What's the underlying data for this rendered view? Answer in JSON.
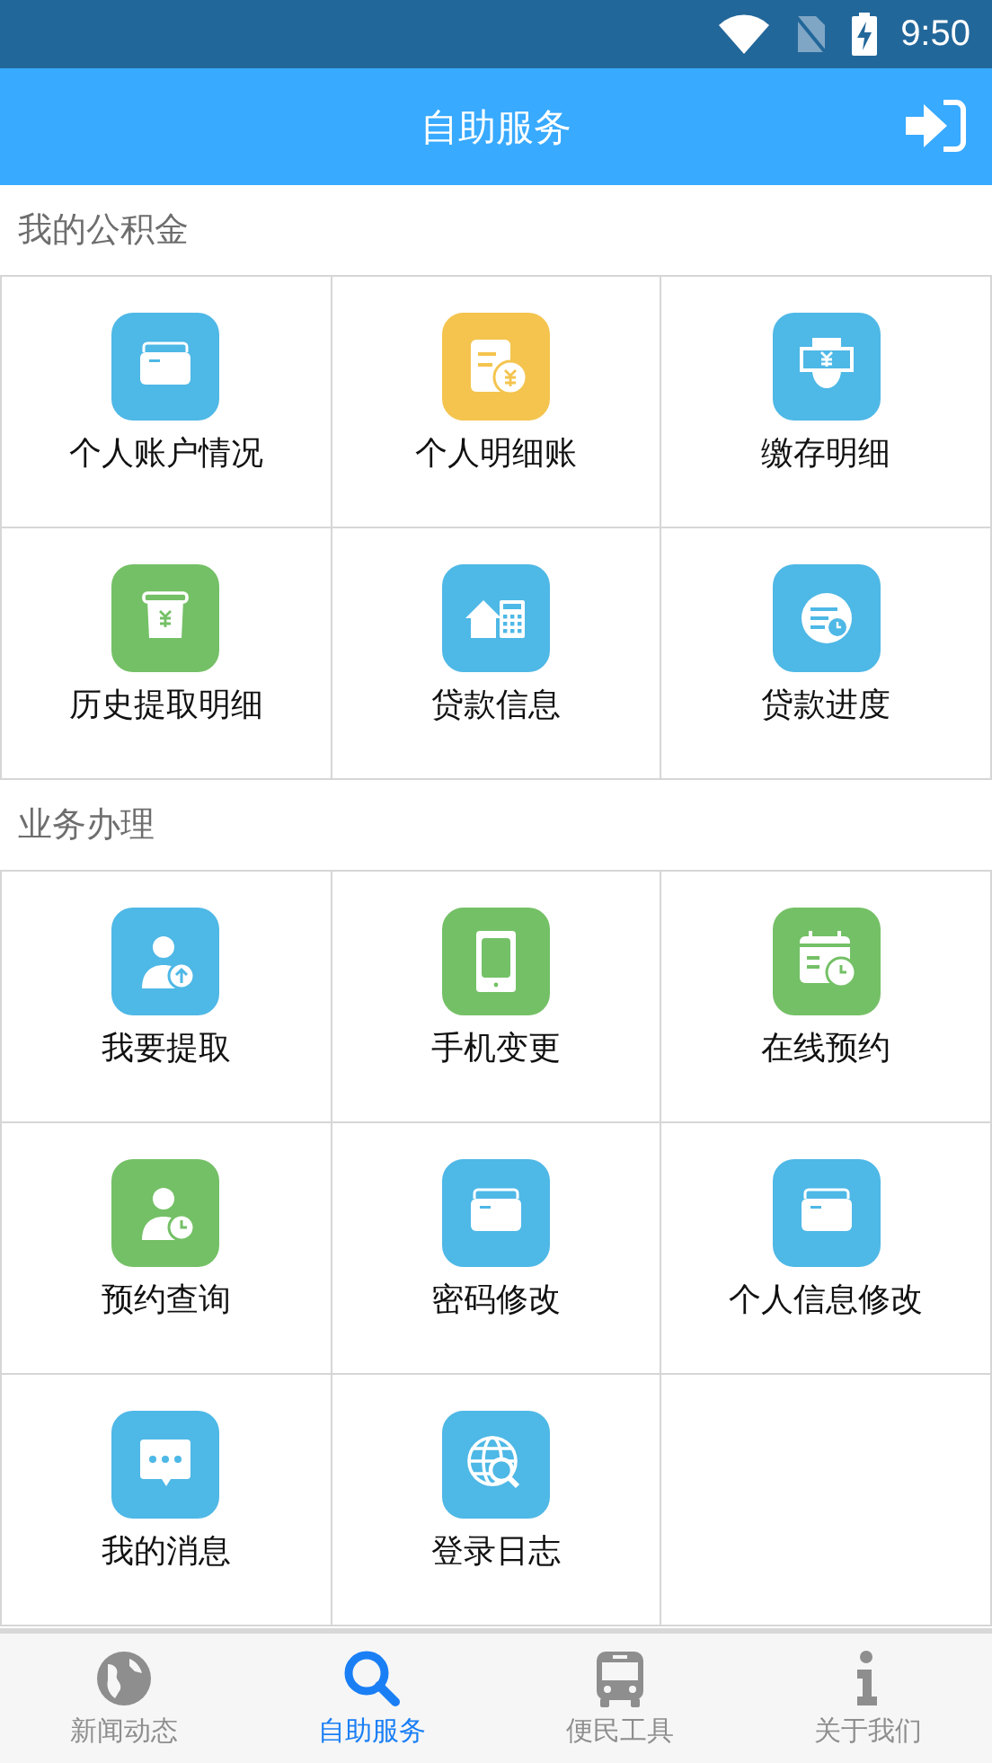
{
  "status_bar": {
    "time": "9:50"
  },
  "header": {
    "title": "自助服务"
  },
  "sections": [
    {
      "title": "我的公积金",
      "items": [
        {
          "label": "个人账户情况",
          "kind": "folder",
          "color": "#4eb8e6"
        },
        {
          "label": "个人明细账",
          "kind": "bill",
          "color": "#f4c44e"
        },
        {
          "label": "缴存明细",
          "kind": "hand",
          "color": "#4eb8e6"
        },
        {
          "label": "历史提取明细",
          "kind": "atm",
          "color": "#74c066"
        },
        {
          "label": "贷款信息",
          "kind": "house",
          "color": "#4eb8e6"
        },
        {
          "label": "贷款进度",
          "kind": "progress",
          "color": "#4eb8e6"
        }
      ]
    },
    {
      "title": "业务办理",
      "items": [
        {
          "label": "我要提取",
          "kind": "personup",
          "color": "#4eb8e6"
        },
        {
          "label": "手机变更",
          "kind": "phone",
          "color": "#74c066"
        },
        {
          "label": "在线预约",
          "kind": "calendar",
          "color": "#74c066"
        },
        {
          "label": "预约查询",
          "kind": "personclock",
          "color": "#74c066"
        },
        {
          "label": "密码修改",
          "kind": "folder",
          "color": "#4eb8e6"
        },
        {
          "label": "个人信息修改",
          "kind": "folder",
          "color": "#4eb8e6"
        },
        {
          "label": "我的消息",
          "kind": "message",
          "color": "#4eb8e6"
        },
        {
          "label": "登录日志",
          "kind": "globesearch",
          "color": "#4eb8e6"
        }
      ]
    }
  ],
  "tabs": [
    {
      "label": "新闻动态",
      "kind": "globe",
      "selected": false
    },
    {
      "label": "自助服务",
      "kind": "search",
      "selected": true
    },
    {
      "label": "便民工具",
      "kind": "bus",
      "selected": false
    },
    {
      "label": "关于我们",
      "kind": "info",
      "selected": false
    }
  ]
}
